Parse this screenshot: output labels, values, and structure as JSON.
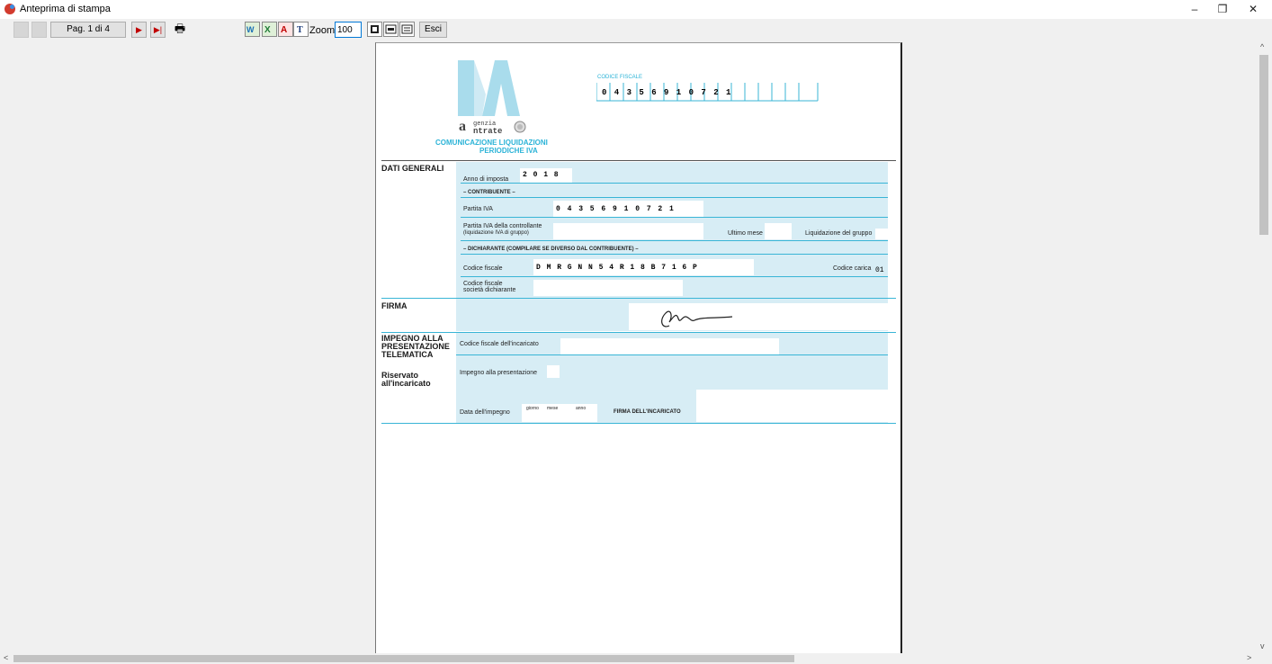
{
  "window": {
    "title": "Anteprima di stampa",
    "min_glyph": "–",
    "restore_glyph": "❐",
    "close_glyph": "✕"
  },
  "toolbar": {
    "page_label": "Pag. 1 di 4",
    "zoom_label": "Zoom",
    "zoom_value": "100",
    "exit_label": "Esci"
  },
  "form": {
    "codice_fiscale_title": "CODICE FISCALE",
    "codice_fiscale_digits": "0 4 3 5 6 9 1 0 7 2 1",
    "agency_top": "genzia",
    "agency_bottom": "ntrate",
    "form_title_1": "COMUNICAZIONE LIQUIDAZIONI",
    "form_title_2": "PERIODICHE IVA",
    "dati_generali": "DATI GENERALI",
    "anno_label": "Anno di imposta",
    "anno_value": "2 0 1 8",
    "contribuente": "– CONTRIBUENTE –",
    "partita_iva_label": "Partita IVA",
    "partita_iva_value": "0 4 3 5 6 9 1 0 7 2 1",
    "piva_controllante_1": "Partita IVA della controllante",
    "piva_controllante_2": "(liquidazione IVA di gruppo)",
    "ultimo_mese": "Ultimo mese",
    "liquidazione_gruppo": "Liquidazione del gruppo",
    "dichiarante": "– DICHIARANTE (COMPILARE SE DIVERSO DAL CONTRIBUENTE) –",
    "cf_label": "Codice fiscale",
    "cf_value": "D M R G N N 5 4 R 1 8 B 7 1 6 P",
    "codice_carica_label": "Codice carica",
    "codice_carica_value": "01",
    "cf_societa_1": "Codice fiscale",
    "cf_societa_2": "società dichiarante",
    "firma": "FIRMA",
    "impegno_1": "IMPEGNO ALLA",
    "impegno_2": "PRESENTAZIONE",
    "impegno_3": "TELEMATICA",
    "riservato_1": "Riservato",
    "riservato_2": "all'incaricato",
    "cf_incaricato_label": "Codice fiscale dell'incaricato",
    "impegno_presentazione_label": "Impegno alla presentazione",
    "data_impegno_label": "Data dell'impegno",
    "giorno": "giorno",
    "mese": "mese",
    "anno": "anno",
    "firma_incaricato": "FIRMA DELL'INCARICATO"
  },
  "colors": {
    "accent": "#2bb3d7",
    "section_bg": "#d7edf5"
  }
}
